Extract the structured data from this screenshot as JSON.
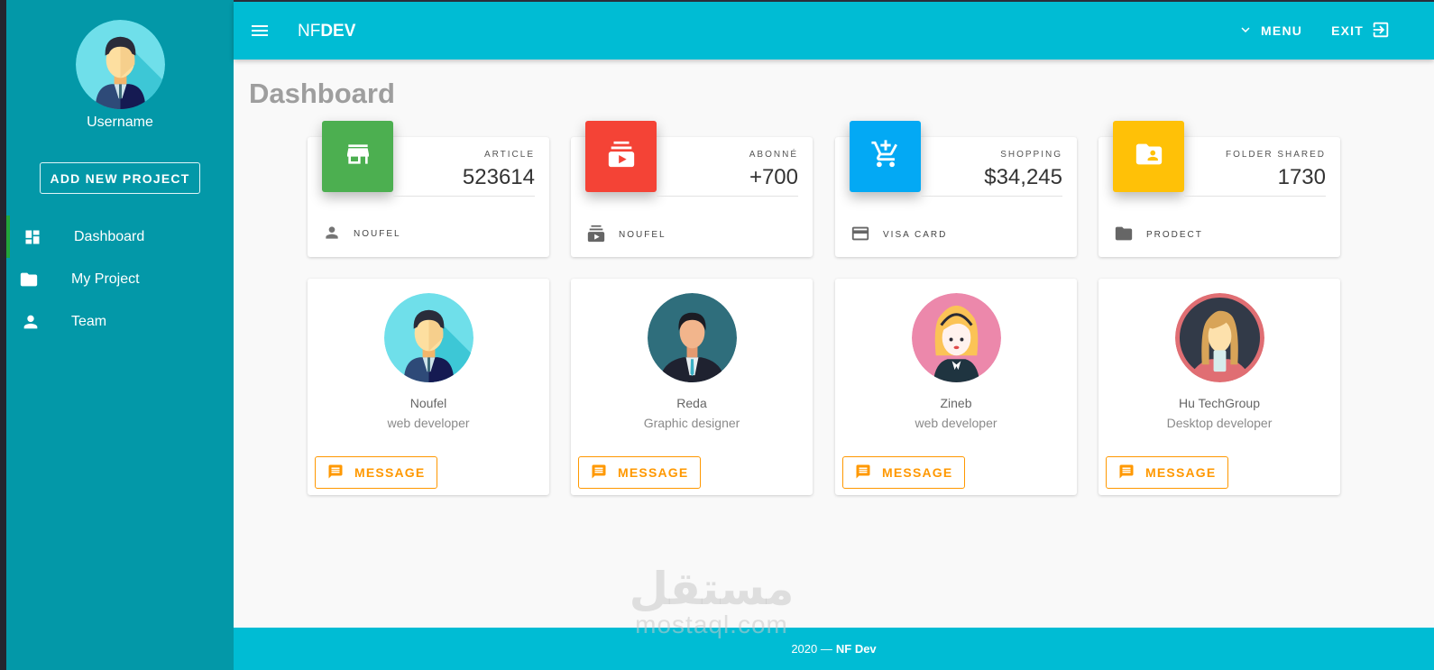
{
  "sidebar": {
    "username": "Username",
    "add_project_label": "ADD NEW PROJECT",
    "items": [
      {
        "label": "Dashboard",
        "icon": "dashboard-icon",
        "active": true
      },
      {
        "label": "My Project",
        "icon": "folder-icon",
        "active": false
      },
      {
        "label": "Team",
        "icon": "person-icon",
        "active": false
      }
    ],
    "active_indicator_color": "#22a53a"
  },
  "topbar": {
    "brand_part1": "NF",
    "brand_part2": "DEV",
    "menu_label": "MENU",
    "exit_label": "EXIT"
  },
  "page": {
    "title": "Dashboard"
  },
  "stats": [
    {
      "label": "ARTICLE",
      "value": "523614",
      "footer": "NOUFEL",
      "icon": "store-icon",
      "footer_icon": "person-icon",
      "color": "#4caf50"
    },
    {
      "label": "ABONNÉ",
      "value": "+700",
      "footer": "NOUFEL",
      "icon": "subscriptions-icon",
      "footer_icon": "subscriptions-icon",
      "color": "#f44336"
    },
    {
      "label": "SHOPPING",
      "value": "$34,245",
      "footer": "VISA CARD",
      "icon": "add-shopping-cart-icon",
      "footer_icon": "credit-card-icon",
      "color": "#03a9f4"
    },
    {
      "label": "FOLDER SHARED",
      "value": "1730",
      "footer": "PRODECT",
      "icon": "folder-shared-icon",
      "footer_icon": "folder-icon",
      "color": "#ffc107"
    }
  ],
  "team": [
    {
      "name": "Noufel",
      "role": "web developer",
      "button": "MESSAGE"
    },
    {
      "name": "Reda",
      "role": "Graphic designer",
      "button": "MESSAGE"
    },
    {
      "name": "Zineb",
      "role": "web developer",
      "button": "MESSAGE"
    },
    {
      "name": "Hu TechGroup",
      "role": "Desktop developer",
      "button": "MESSAGE"
    }
  ],
  "watermark": {
    "arabic": "مستقل",
    "latin": "mostaql.com"
  },
  "footer": {
    "year": "2020 —",
    "brand": "NF Dev"
  },
  "colors": {
    "sidebar_bg": "#0398a8",
    "topbar_bg": "#00bcd4",
    "accent_orange": "#ff9800"
  }
}
